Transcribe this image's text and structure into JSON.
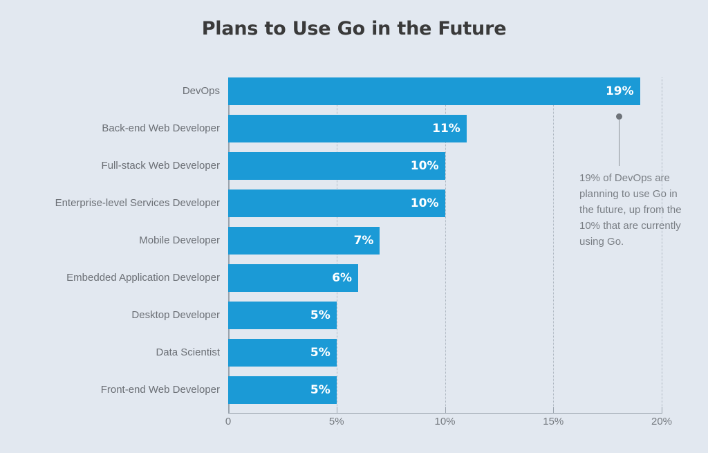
{
  "chart_data": {
    "type": "bar",
    "orientation": "horizontal",
    "title": "Plans to Use Go in the Future",
    "xlabel": "",
    "ylabel": "",
    "xlim": [
      0,
      20
    ],
    "grid": "vertical-dotted",
    "legend": "none",
    "unit": "%",
    "categories": [
      "DevOps",
      "Back-end Web Developer",
      "Full-stack Web Developer",
      "Enterprise-level Services Developer",
      "Mobile Developer",
      "Embedded Application Developer",
      "Desktop Developer",
      "Data Scientist",
      "Front-end Web Developer"
    ],
    "values": [
      19,
      11,
      10,
      10,
      7,
      6,
      5,
      5,
      5
    ],
    "value_labels": [
      "19%",
      "11%",
      "10%",
      "10%",
      "7%",
      "6%",
      "5%",
      "5%",
      "5%"
    ],
    "xticks": [
      0,
      5,
      10,
      15,
      20
    ],
    "xtick_labels": [
      "0",
      "5%",
      "10%",
      "15%",
      "20%"
    ],
    "annotations": [
      {
        "text": "19% of DevOps are planning to use Go in the future, up from the 10% that are currently using Go.",
        "points_to": "DevOps"
      }
    ],
    "colors": {
      "bar": "#1b9ad6",
      "background": "#e2e8f0",
      "title": "#3a3a3a",
      "axis": "#9aa3ad",
      "tick_label": "#74797f",
      "category_label": "#6b6f75",
      "value_label": "#ffffff",
      "annotation_text": "#797e84",
      "annotation_marker": "#6e7379",
      "gridline": "#aab3bd"
    }
  }
}
